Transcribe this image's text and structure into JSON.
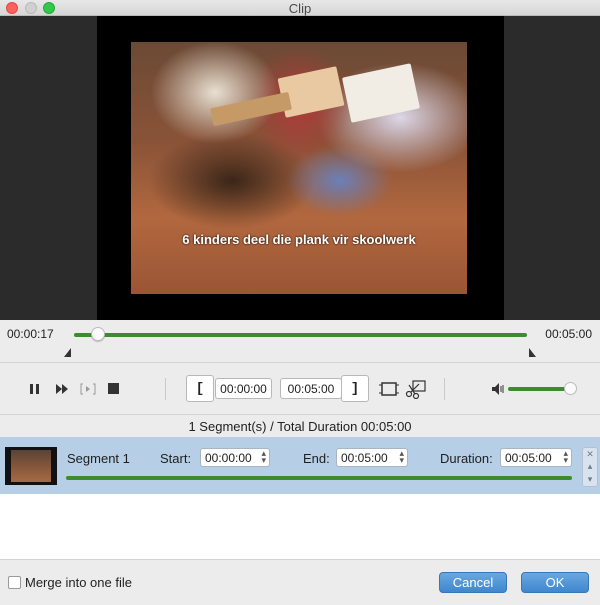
{
  "window": {
    "title": "Clip"
  },
  "video": {
    "subtitle": "6 kinders deel die plank vir skoolwerk"
  },
  "timeline": {
    "current_time": "00:00:17",
    "total_time": "00:05:00",
    "position_fraction": 0.05
  },
  "controls": {
    "pause_icon": "pause-icon",
    "forward_icon": "fast-forward-icon",
    "step_icon": "step-frame-icon",
    "stop_icon": "stop-icon",
    "set_start_label": "[",
    "start_time": "00:00:00",
    "end_time": "00:05:00",
    "set_end_label": "]",
    "split_icon": "film-split-icon",
    "cut_icon": "scissors-icon",
    "volume_icon": "speaker-icon",
    "volume_fraction": 1.0
  },
  "summary": {
    "text": "1 Segment(s) / Total Duration 00:05:00"
  },
  "segments": [
    {
      "name": "Segment 1",
      "start_label": "Start:",
      "start": "00:00:00",
      "end_label": "End:",
      "end": "00:05:00",
      "duration_label": "Duration:",
      "duration": "00:05:00"
    }
  ],
  "footer": {
    "merge_label": "Merge into one file",
    "merge_checked": false,
    "cancel_label": "Cancel",
    "ok_label": "OK"
  },
  "colors": {
    "accent_green": "#3d8b2f",
    "button_blue": "#4a90d9",
    "selection_blue": "#b7cfe6"
  }
}
